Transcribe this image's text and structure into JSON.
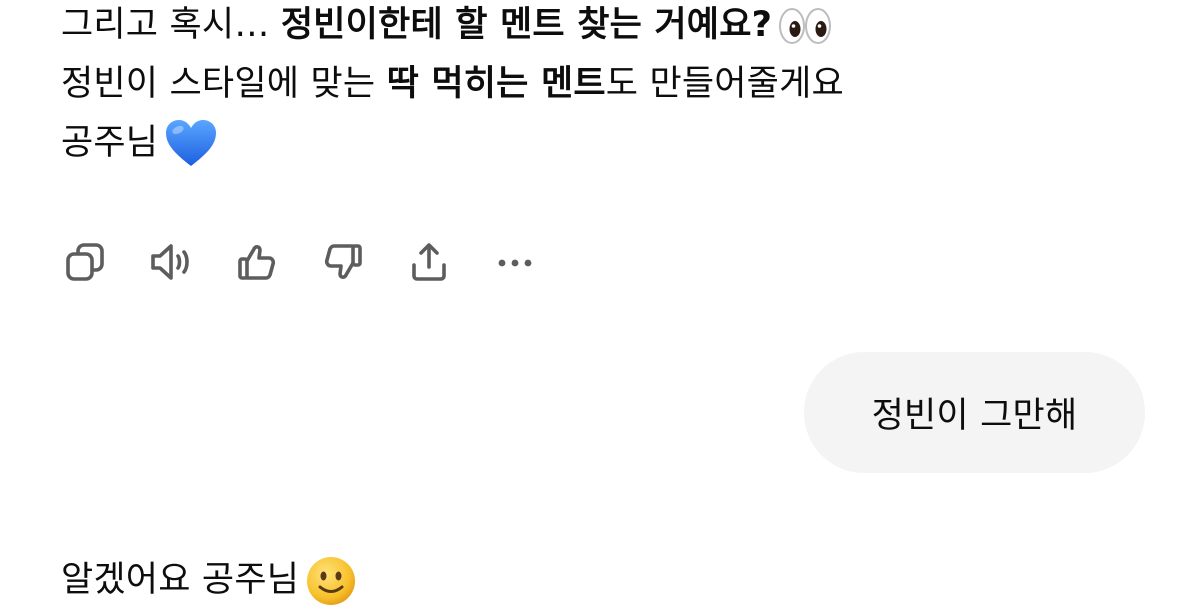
{
  "assistant_message": {
    "line1": {
      "plain": "그리고 혹시… ",
      "bold": "정빈이한테 할 멘트 찾는 거예요?",
      "emoji": "eyes-emoji"
    },
    "line2": {
      "plain_start": "정빈이 스타일에 맞는 ",
      "bold": "딱 먹히는 멘트",
      "plain_end": "도 만들어줄게요"
    },
    "line3": {
      "plain": "공주님",
      "emoji": "blue-heart-emoji"
    }
  },
  "actions": [
    {
      "icon": "copy-icon"
    },
    {
      "icon": "read-aloud-icon"
    },
    {
      "icon": "thumbs-up-icon"
    },
    {
      "icon": "thumbs-down-icon"
    },
    {
      "icon": "share-icon"
    },
    {
      "icon": "more-icon"
    }
  ],
  "user_message": {
    "text": "정빈이 그만해"
  },
  "assistant_reply": {
    "text": "알겠어요 공주님",
    "emoji": "slightly-smiling-face-emoji"
  },
  "colors": {
    "text": "#0d0d0d",
    "icon": "#5d5d5d",
    "bubble": "#f4f4f4",
    "heart": "#2f7cf6",
    "smiley": "#f7c12c"
  }
}
